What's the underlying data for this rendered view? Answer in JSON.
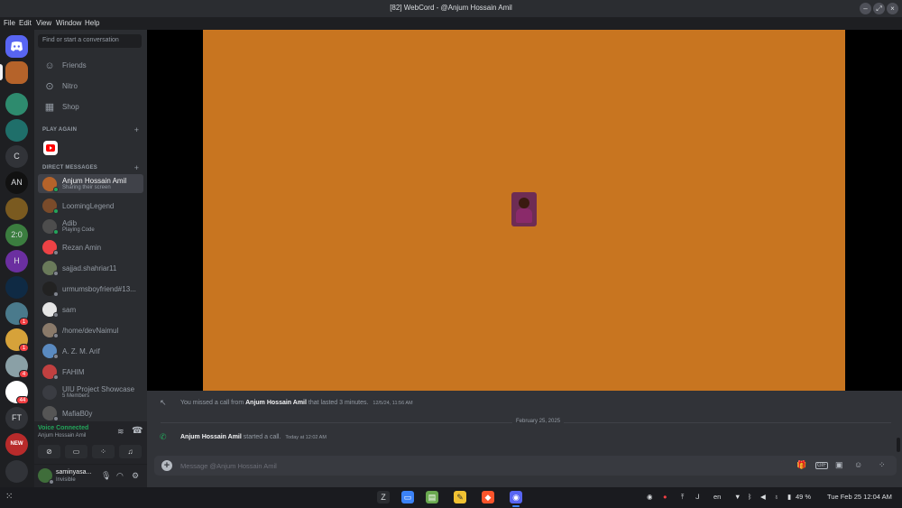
{
  "window": {
    "title": "[82] WebCord - @Anjum Hossain Amil"
  },
  "menu": [
    "File",
    "Edit",
    "View",
    "Window",
    "Help"
  ],
  "guilds": [
    {
      "text": ""
    },
    {
      "text": ""
    },
    {
      "text": ""
    },
    {
      "text": ""
    },
    {
      "text": "C"
    },
    {
      "text": "AN"
    },
    {
      "text": ""
    },
    {
      "text": "2:0"
    },
    {
      "text": "H"
    },
    {
      "text": ""
    },
    {
      "text": ""
    },
    {
      "text": ""
    },
    {
      "text": ""
    },
    {
      "text": ""
    },
    {
      "text": "FT"
    },
    {
      "text": "NEW"
    },
    {
      "text": ""
    }
  ],
  "badges": [
    "1",
    "1",
    "4",
    "44"
  ],
  "sidebar": {
    "search_placeholder": "Find or start a conversation",
    "nav": [
      {
        "label": "Friends",
        "icon": "friends-icon"
      },
      {
        "label": "Nitro",
        "icon": "nitro-icon"
      },
      {
        "label": "Shop",
        "icon": "shop-icon"
      }
    ],
    "play_again": "PLAY AGAIN",
    "direct_messages": "DIRECT MESSAGES",
    "dms": [
      {
        "name": "Anjum Hossain Amil",
        "sub": "Sharing their screen"
      },
      {
        "name": "LoomingLegend",
        "sub": ""
      },
      {
        "name": "Adib",
        "sub": "Playing Code"
      },
      {
        "name": "Rezan Amin",
        "sub": ""
      },
      {
        "name": "sajjad.shahriar11",
        "sub": ""
      },
      {
        "name": "urmumsboyfriend#13...",
        "sub": ""
      },
      {
        "name": "sam",
        "sub": ""
      },
      {
        "name": "/home/devNaimul",
        "sub": ""
      },
      {
        "name": "A. Z. M. Arif",
        "sub": ""
      },
      {
        "name": "FAHIM",
        "sub": ""
      },
      {
        "name": "UIU Project Showcase",
        "sub": "5 Members"
      },
      {
        "name": "MafiaB0y",
        "sub": ""
      }
    ]
  },
  "voice": {
    "status": "Voice Connected",
    "channel": "Anjum Hossain Amil"
  },
  "user": {
    "name": "saminyasa...",
    "status": "Invisible"
  },
  "messages": {
    "missed_prefix": "You missed a call from",
    "missed_name": "Anjum Hossain Amil",
    "missed_suffix": "that lasted 3 minutes.",
    "missed_time": "12/5/24, 11:56 AM",
    "date_divider": "February 25, 2025",
    "call_name": "Anjum Hossain Amil",
    "call_text": "started a call.",
    "call_time": "Today at 12:02 AM"
  },
  "composer": {
    "placeholder": "Message @Anjum Hossain Amil"
  },
  "taskbar": {
    "lang": "en",
    "battery": "49 %",
    "clock": "Tue Feb 25  12:04 AM"
  },
  "colors": {
    "accent": "#5865f2",
    "online": "#23a55a",
    "idle": "#80848e",
    "danger": "#f23f43",
    "share_bg": "#c87520"
  }
}
